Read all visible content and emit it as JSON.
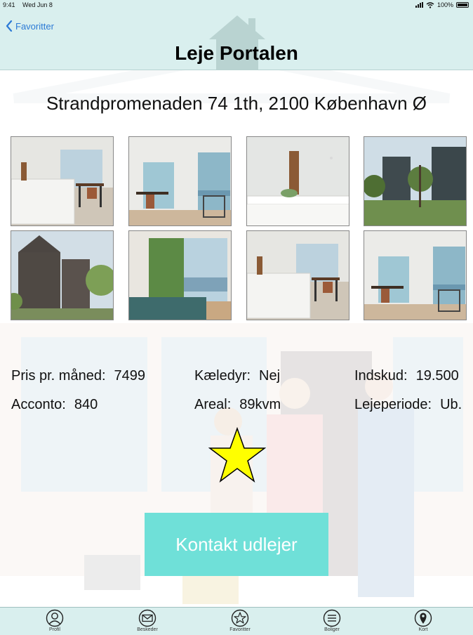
{
  "status_bar": {
    "time": "9:41",
    "date": "Wed Jun 8",
    "battery": "100%"
  },
  "nav": {
    "back_label": "Favoritter",
    "title": "Leje Portalen"
  },
  "listing": {
    "address": "Strandpromenaden 74 1th, 2100 København Ø",
    "photos": [
      {
        "kind": "kitchen"
      },
      {
        "kind": "dining"
      },
      {
        "kind": "bathroom"
      },
      {
        "kind": "exterior-green"
      },
      {
        "kind": "exterior-brick"
      },
      {
        "kind": "bedroom"
      },
      {
        "kind": "kitchen"
      },
      {
        "kind": "dining"
      }
    ],
    "info": {
      "price_label": "Pris pr. måned:",
      "price_value": "7499",
      "pets_label": "Kæledyr:",
      "pets_value": "Nej",
      "deposit_label": "Indskud:",
      "deposit_value": "19.500",
      "utilities_label": "Acconto:",
      "utilities_value": "840",
      "area_label": "Areal:",
      "area_value": "89kvm",
      "period_label": "Lejeperiode:",
      "period_value": "Ub."
    },
    "favorite_icon": "star-icon",
    "contact_label": "Kontakt udlejer"
  },
  "tabs": [
    {
      "label": "Profil",
      "icon": "profile-icon"
    },
    {
      "label": "Beskeder",
      "icon": "envelope-icon"
    },
    {
      "label": "Favoritter",
      "icon": "star-icon"
    },
    {
      "label": "Boliger",
      "icon": "list-icon"
    },
    {
      "label": "Kort",
      "icon": "map-pin-icon"
    }
  ],
  "colors": {
    "header_bg": "#d9efee",
    "accent_button": "#6fe0d8",
    "star_fill": "#ffff00",
    "link_blue": "#2c7ad6"
  }
}
